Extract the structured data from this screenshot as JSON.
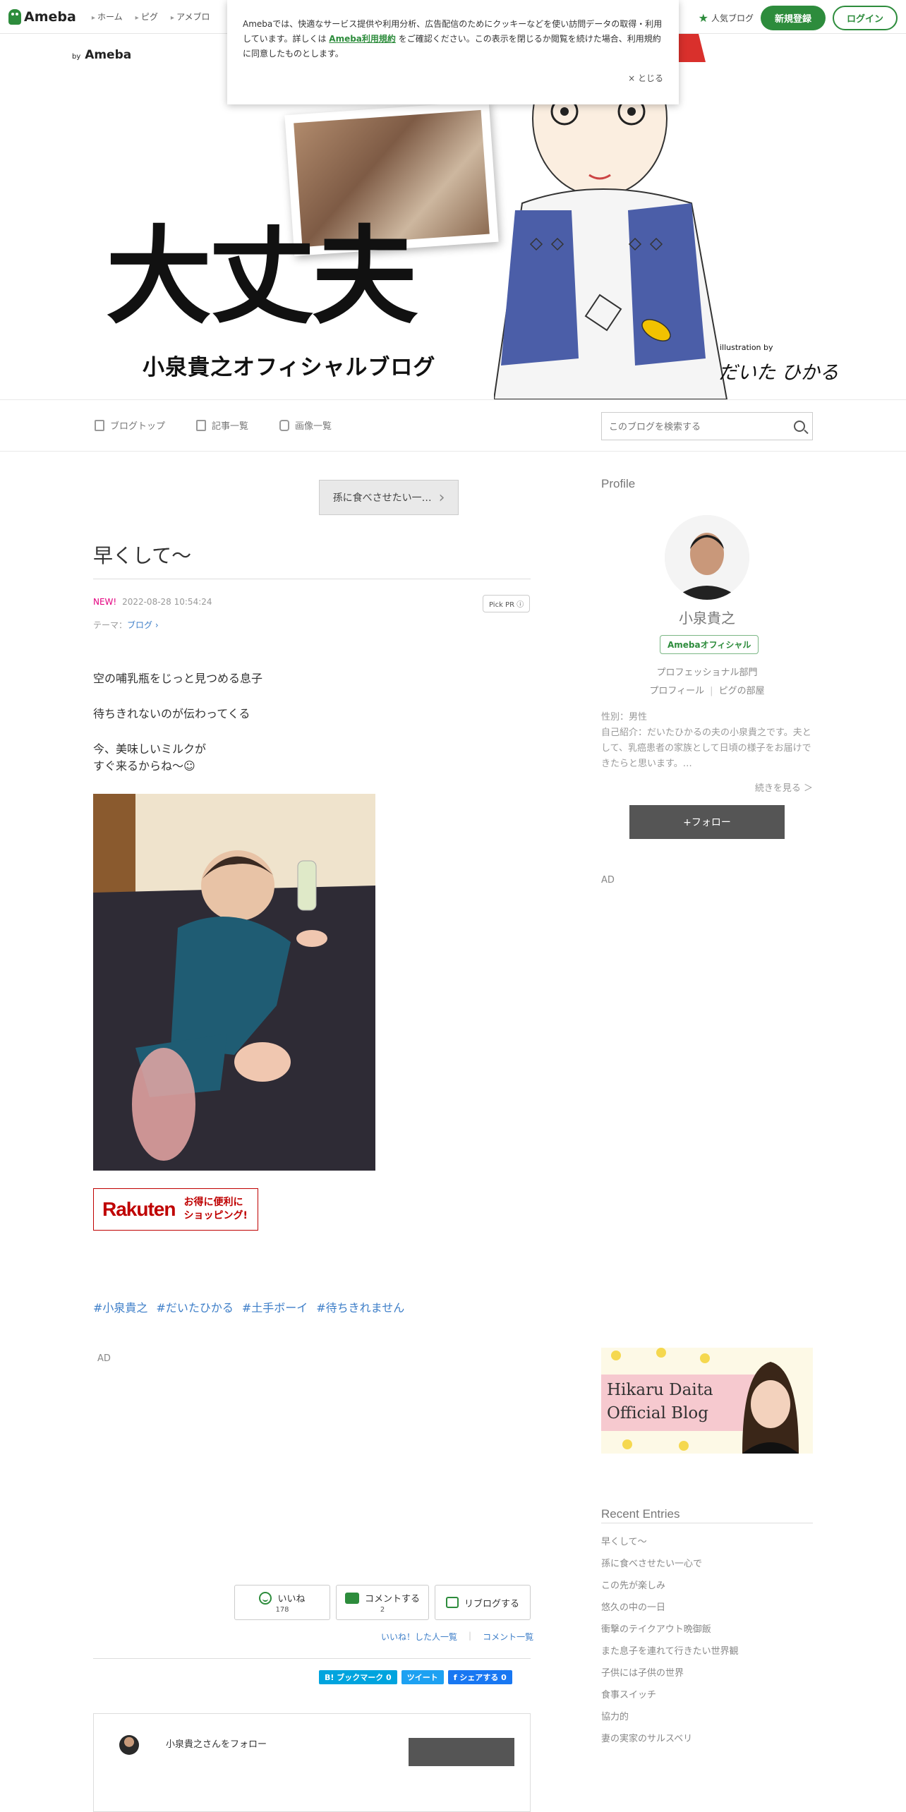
{
  "topbar": {
    "logo": "Ameba",
    "nav": [
      "ホーム",
      "ピグ",
      "アメブロ"
    ],
    "popular": "人気ブログ",
    "signup": "新規登録",
    "login": "ログイン"
  },
  "cookie": {
    "text1": "Amebaでは、快適なサービス提供や利用分析、広告配信のためにクッキーなどを使い訪問データの取得・利用しています。詳しくは",
    "link": "Ameba利用規約",
    "text2": "をご確認ください。この表示を閉じるか閲覧を続けた場合、利用規約に同意したものとします。",
    "close": "× とじる"
  },
  "header": {
    "by": "by",
    "brand": "Ameba",
    "title": "大丈夫",
    "subtitle": "小泉貴之オフィシャルブログ",
    "illustration_by": "illustration by",
    "illustrator": "だいた ひかる"
  },
  "blognav": {
    "items": [
      "ブログトップ",
      "記事一覧",
      "画像一覧"
    ],
    "search_placeholder": "このブログを検索する"
  },
  "post": {
    "prev_label": "孫に食べさせたい一…",
    "title": "早くして〜",
    "new_label": "NEW!",
    "date": "2022-08-28 10:54:24",
    "pickpr": "Pick PR ⓘ",
    "theme_label": "テーマ：",
    "theme": "ブログ ›",
    "para1": "空の哺乳瓶をじっと見つめる息子",
    "para2": "待ちきれないのが伝わってくる",
    "para3a": "今、美味しいミルクが",
    "para3b": "すぐ来るからね〜☺",
    "rakuten_logo": "Rakuten",
    "rakuten_text1": "お得に便利に",
    "rakuten_text2": "ショッピング!",
    "hashtags": [
      "#小泉貴之",
      "#だいたひかる",
      "#土手ボーイ",
      "#待ちきれません"
    ],
    "ad": "AD"
  },
  "reactions": {
    "like": "いいね",
    "like_count": "178",
    "comment": "コメントする",
    "comment_count": "2",
    "reblog": "リブログする",
    "liked_people": "いいね！した人一覧",
    "comment_list": "コメント一覧"
  },
  "shares": {
    "hatena": "B! ブックマーク 0",
    "tweet": "ツイート",
    "facebook": "f シェアする 0"
  },
  "followbox": {
    "text": "小泉貴之さんをフォロー"
  },
  "sidebar": {
    "profile_title": "Profile",
    "name": "小泉貴之",
    "official": "Amebaオフィシャル",
    "category": "プロフェッショナル部門",
    "link_profile": "プロフィール",
    "link_pig": "ピグの部屋",
    "gender": "性別：男性",
    "intro": "自己紹介：だいたひかるの夫の小泉貴之です。夫として、乳癌患者の家族として日頃の様子をお届けできたらと思います。…",
    "more": "続きを見る ＞",
    "follow": "+フォロー",
    "ad": "AD",
    "banner_line1": "Hikaru Daita",
    "banner_line2": "Official Blog",
    "recent_title": "Recent Entries",
    "recent": [
      "早くして〜",
      "孫に食べさせたい一心で",
      "この先が楽しみ",
      "悠久の中の一日",
      "衝撃のテイクアウト晩御飯",
      "また息子を連れて行きたい世界観",
      "子供には子供の世界",
      "食事スイッチ",
      "協力的",
      "妻の実家のサルスベリ"
    ]
  },
  "colors": {
    "accent": "#2d8c3c",
    "link": "#3d7ec8",
    "new": "#e3007f",
    "rakuten": "#bf0000"
  }
}
